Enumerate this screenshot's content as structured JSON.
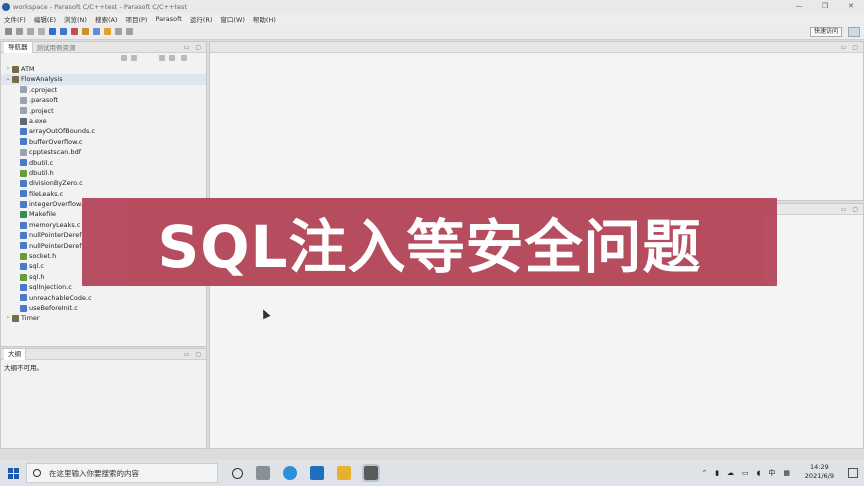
{
  "window": {
    "title": "workspace - Parasoft C/C++test - Parasoft C/C++test",
    "controls": {
      "minimize": "—",
      "maximize": "❐",
      "close": "✕"
    }
  },
  "menubar": [
    "文件(F)",
    "编辑(E)",
    "浏览(N)",
    "搜索(A)",
    "项目(P)",
    "Parasoft",
    "运行(R)",
    "窗口(W)",
    "帮助(H)"
  ],
  "toolbar": {
    "quick_access": "快速访问"
  },
  "navigator": {
    "tabs": [
      "导航器",
      "测试用例资源"
    ],
    "tree": [
      {
        "label": "ATM",
        "level": 1,
        "arrow": "›",
        "icon": "project"
      },
      {
        "label": "FlowAnalysis",
        "level": 1,
        "arrow": "⌄",
        "icon": "project",
        "selected": true
      },
      {
        "label": ".cproject",
        "level": 2,
        "icon": "file"
      },
      {
        "label": ".parasoft",
        "level": 2,
        "icon": "file"
      },
      {
        "label": ".project",
        "level": 2,
        "icon": "file"
      },
      {
        "label": "a.exe",
        "level": 2,
        "icon": "exe"
      },
      {
        "label": "arrayOutOfBounds.c",
        "level": 2,
        "icon": "c"
      },
      {
        "label": "bufferOverflow.c",
        "level": 2,
        "icon": "c"
      },
      {
        "label": "cpptestscan.bdf",
        "level": 2,
        "icon": "file"
      },
      {
        "label": "dbutil.c",
        "level": 2,
        "icon": "c"
      },
      {
        "label": "dbutil.h",
        "level": 2,
        "icon": "h"
      },
      {
        "label": "divisionByZero.c",
        "level": 2,
        "icon": "c"
      },
      {
        "label": "fileLeaks.c",
        "level": 2,
        "icon": "c"
      },
      {
        "label": "integerOverflow.",
        "level": 2,
        "icon": "c"
      },
      {
        "label": "Makefile",
        "level": 2,
        "icon": "make"
      },
      {
        "label": "memoryLeaks.c",
        "level": 2,
        "icon": "c"
      },
      {
        "label": "nullPointerDeref",
        "level": 2,
        "icon": "c"
      },
      {
        "label": "nullPointerDeref",
        "level": 2,
        "icon": "c"
      },
      {
        "label": "socket.h",
        "level": 2,
        "icon": "h"
      },
      {
        "label": "sql.c",
        "level": 2,
        "icon": "c"
      },
      {
        "label": "sql.h",
        "level": 2,
        "icon": "h"
      },
      {
        "label": "sqlInjection.c",
        "level": 2,
        "icon": "c"
      },
      {
        "label": "unreachableCode.c",
        "level": 2,
        "icon": "c"
      },
      {
        "label": "useBeforeInit.c",
        "level": 2,
        "icon": "c"
      },
      {
        "label": "Timer",
        "level": 1,
        "arrow": "›",
        "icon": "project"
      }
    ]
  },
  "outline": {
    "tab": "大纲",
    "message": "大纲不可用。"
  },
  "banner": {
    "text": "SQL注入等安全问题"
  },
  "taskbar": {
    "search_placeholder": "在这里输入你要搜索的内容",
    "ime": "中",
    "time": "14:29",
    "date": "2021/6/9"
  },
  "colors": {
    "banner": "#b34558",
    "c_file": "#4a7bc8",
    "h_file": "#6a9a3a",
    "project": "#7a6a4a",
    "file": "#9aa3ad",
    "exe": "#5a6a7a",
    "make": "#3c8a5a"
  }
}
